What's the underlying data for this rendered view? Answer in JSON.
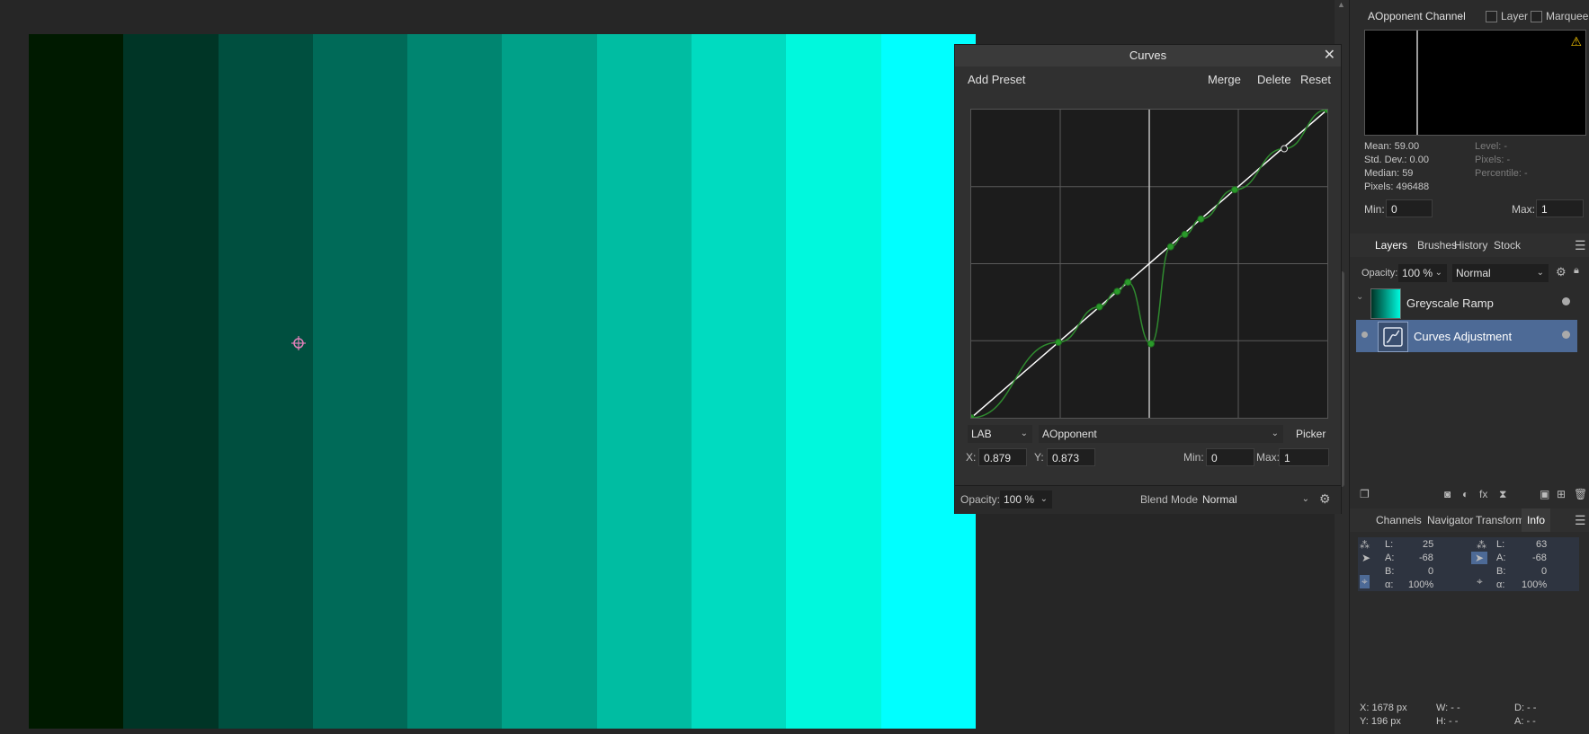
{
  "canvas": {
    "ramp_colors": [
      "#001a00",
      "#003526",
      "#004f3f",
      "#006a58",
      "#008570",
      "#00a189",
      "#00bda2",
      "#00dbc0",
      "#00f8dd",
      "#00ffff"
    ]
  },
  "curves": {
    "title": "Curves",
    "toolbar": {
      "add_preset": "Add Preset",
      "merge": "Merge",
      "delete": "Delete",
      "reset": "Reset"
    },
    "colorspace": "LAB",
    "channel": "AOpponent",
    "picker": "Picker",
    "x_label": "X:",
    "x_value": "0.879",
    "y_label": "Y:",
    "y_value": "0.873",
    "min_label": "Min:",
    "min_value": "0",
    "max_label": "Max:",
    "max_value": "1",
    "opacity_label": "Opacity:",
    "opacity_value": "100 %",
    "blend_label": "Blend Mode:",
    "blend_value": "Normal",
    "curve_points": [
      [
        0,
        0
      ],
      [
        0.245,
        0.245
      ],
      [
        0.36,
        0.36
      ],
      [
        0.41,
        0.41
      ],
      [
        0.44,
        0.44
      ],
      [
        0.505,
        0.24
      ],
      [
        0.56,
        0.555
      ],
      [
        0.6,
        0.595
      ],
      [
        0.645,
        0.645
      ],
      [
        0.74,
        0.74
      ],
      [
        0.879,
        0.873
      ],
      [
        1,
        1
      ]
    ]
  },
  "histogram": {
    "channel": "AOpponent Channel",
    "layer_label": "Layer",
    "marquee_label": "Marquee",
    "warning_icon": "warning-icon",
    "stats_left": [
      "Mean: 59.00",
      "Std. Dev.: 0.00",
      "Median: 59",
      "Pixels: 496488"
    ],
    "stats_right": [
      "Level: -",
      "Pixels: -",
      "Percentile: -"
    ],
    "min_label": "Min:",
    "min_value": "0",
    "max_label": "Max:",
    "max_value": "1"
  },
  "layers_panel": {
    "tabs": [
      "Layers",
      "Brushes",
      "History",
      "Stock"
    ],
    "opacity_label": "Opacity:",
    "opacity_value": "100 %",
    "blend_value": "Normal",
    "layers": [
      {
        "name": "Greyscale Ramp"
      },
      {
        "name": "Curves Adjustment"
      }
    ]
  },
  "info_panel": {
    "tabs": [
      "Channels",
      "Navigator",
      "Transform",
      "Info"
    ],
    "left": {
      "L": "25",
      "A": "-68",
      "B": "0",
      "alpha": "100%"
    },
    "right": {
      "L": "63",
      "A": "-68",
      "B": "0",
      "alpha": "100%"
    },
    "labels": {
      "L": "L:",
      "A": "A:",
      "B": "B:",
      "alpha": "α:"
    }
  },
  "status": {
    "x": "X: 1678 px",
    "y": "Y: 196 px",
    "w": "W: - -",
    "h": "H: - -",
    "d": "D: - -",
    "a": "A: - -"
  }
}
